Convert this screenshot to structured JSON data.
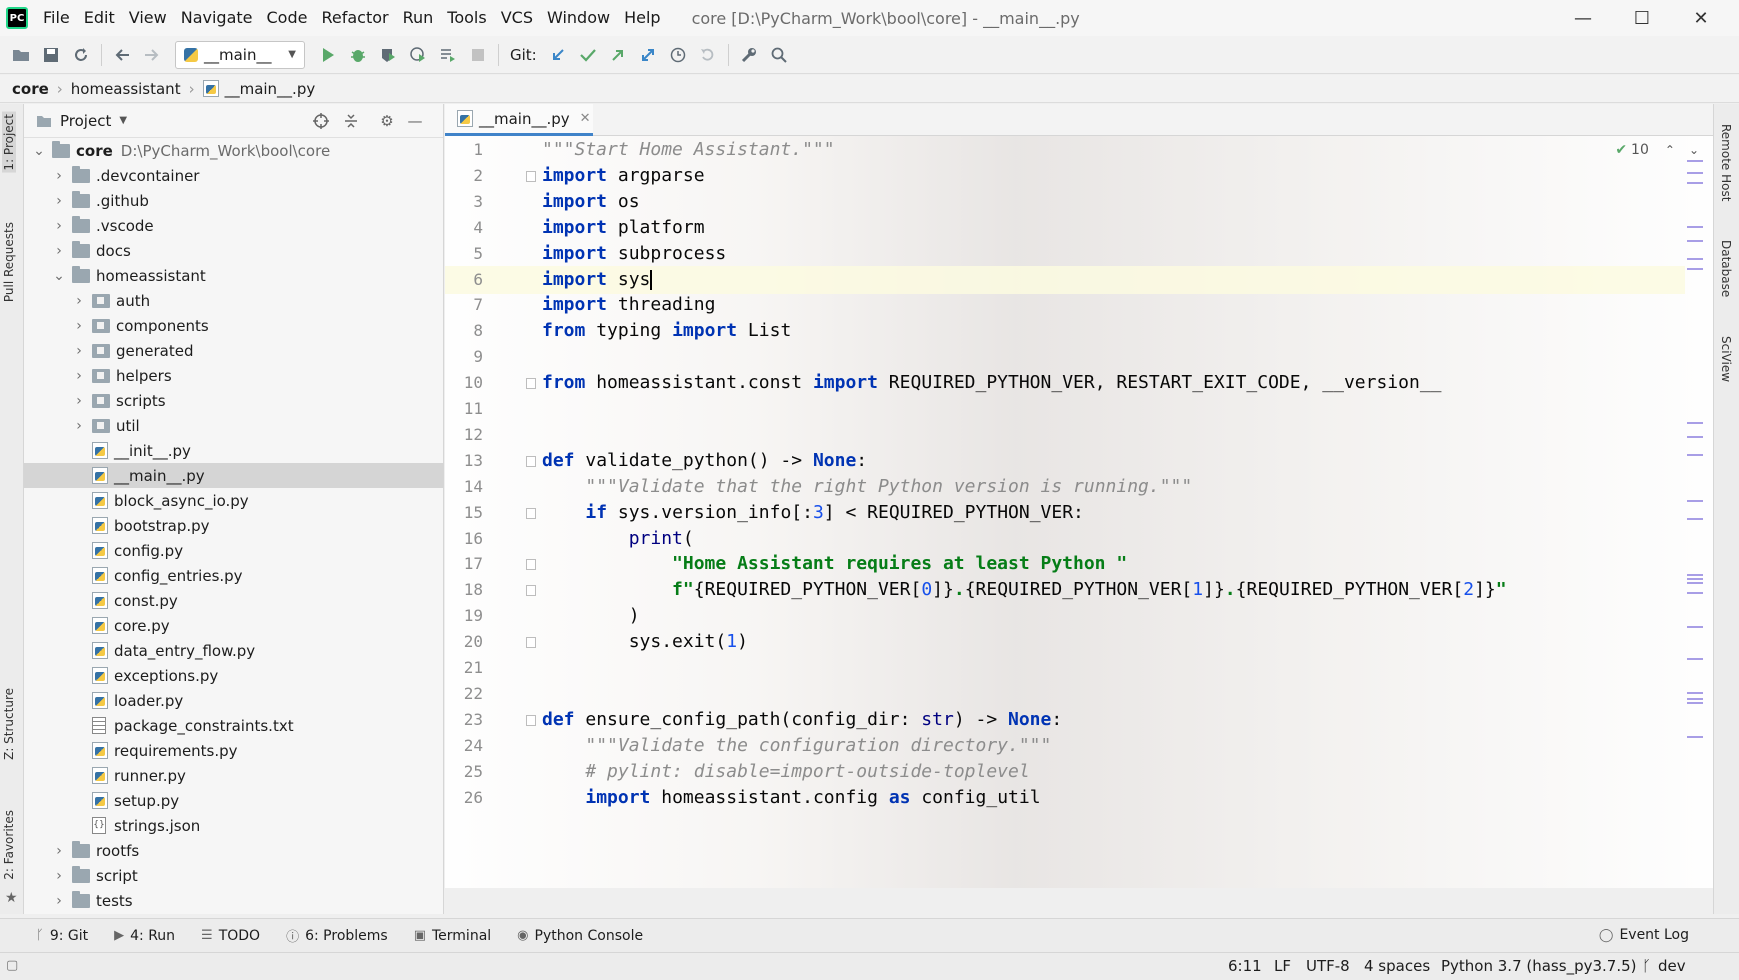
{
  "window": {
    "app_logo": "PC",
    "title": "core [D:\\PyCharm_Work\\bool\\core] - __main__.py",
    "minimize": "—",
    "maximize": "☐",
    "close": "✕"
  },
  "menu": [
    "File",
    "Edit",
    "View",
    "Navigate",
    "Code",
    "Refactor",
    "Run",
    "Tools",
    "VCS",
    "Window",
    "Help"
  ],
  "toolbar": {
    "run_config": "__main__",
    "git_label": "Git:"
  },
  "breadcrumb": [
    "core",
    "homeassistant",
    "__main__.py"
  ],
  "left_tabs": {
    "project": "1: Project",
    "pull_requests": "Pull Requests",
    "structure": "Z: Structure",
    "favorites": "2: Favorites"
  },
  "right_tabs": {
    "remote_host": "Remote Host",
    "database": "Database",
    "sciview": "SciView"
  },
  "project_panel": {
    "title": "Project",
    "tree": [
      {
        "label": "core",
        "path": "D:\\PyCharm_Work\\bool\\core",
        "type": "root",
        "depth": 0,
        "expanded": true
      },
      {
        "label": ".devcontainer",
        "type": "folder",
        "depth": 1,
        "expanded": false
      },
      {
        "label": ".github",
        "type": "folder",
        "depth": 1,
        "expanded": false
      },
      {
        "label": ".vscode",
        "type": "folder",
        "depth": 1,
        "expanded": false
      },
      {
        "label": "docs",
        "type": "folder",
        "depth": 1,
        "expanded": false
      },
      {
        "label": "homeassistant",
        "type": "folder",
        "depth": 1,
        "expanded": true
      },
      {
        "label": "auth",
        "type": "package",
        "depth": 2,
        "expanded": false
      },
      {
        "label": "components",
        "type": "package",
        "depth": 2,
        "expanded": false
      },
      {
        "label": "generated",
        "type": "package",
        "depth": 2,
        "expanded": false
      },
      {
        "label": "helpers",
        "type": "package",
        "depth": 2,
        "expanded": false
      },
      {
        "label": "scripts",
        "type": "package",
        "depth": 2,
        "expanded": false
      },
      {
        "label": "util",
        "type": "package",
        "depth": 2,
        "expanded": false
      },
      {
        "label": "__init__.py",
        "type": "py",
        "depth": 2
      },
      {
        "label": "__main__.py",
        "type": "py",
        "depth": 2,
        "selected": true
      },
      {
        "label": "block_async_io.py",
        "type": "py",
        "depth": 2
      },
      {
        "label": "bootstrap.py",
        "type": "py",
        "depth": 2
      },
      {
        "label": "config.py",
        "type": "py",
        "depth": 2
      },
      {
        "label": "config_entries.py",
        "type": "py",
        "depth": 2
      },
      {
        "label": "const.py",
        "type": "py",
        "depth": 2
      },
      {
        "label": "core.py",
        "type": "py",
        "depth": 2
      },
      {
        "label": "data_entry_flow.py",
        "type": "py",
        "depth": 2
      },
      {
        "label": "exceptions.py",
        "type": "py",
        "depth": 2
      },
      {
        "label": "loader.py",
        "type": "py",
        "depth": 2
      },
      {
        "label": "package_constraints.txt",
        "type": "txt",
        "depth": 2
      },
      {
        "label": "requirements.py",
        "type": "py",
        "depth": 2
      },
      {
        "label": "runner.py",
        "type": "py",
        "depth": 2
      },
      {
        "label": "setup.py",
        "type": "py",
        "depth": 2
      },
      {
        "label": "strings.json",
        "type": "json",
        "depth": 2
      },
      {
        "label": "rootfs",
        "type": "folder",
        "depth": 1,
        "expanded": false
      },
      {
        "label": "script",
        "type": "folder",
        "depth": 1,
        "expanded": false
      },
      {
        "label": "tests",
        "type": "folder",
        "depth": 1,
        "expanded": false
      }
    ]
  },
  "editor": {
    "tab_label": "__main__.py",
    "inspection_count": "10",
    "caret_line": 6,
    "line_numbers": [
      "1",
      "2",
      "3",
      "4",
      "5",
      "6",
      "7",
      "8",
      "9",
      "10",
      "11",
      "12",
      "13",
      "14",
      "15",
      "16",
      "17",
      "18",
      "19",
      "20",
      "21",
      "22",
      "23",
      "24",
      "25",
      "26"
    ],
    "code_lines": [
      [
        [
          "doc",
          "\"\"\"Start Home Assistant.\"\"\""
        ]
      ],
      [
        [
          "kw",
          "import"
        ],
        [
          "",
          " argparse"
        ]
      ],
      [
        [
          "kw",
          "import"
        ],
        [
          "",
          " os"
        ]
      ],
      [
        [
          "kw",
          "import"
        ],
        [
          "",
          " platform"
        ]
      ],
      [
        [
          "kw",
          "import"
        ],
        [
          "",
          " subprocess"
        ]
      ],
      [
        [
          "kw",
          "import"
        ],
        [
          "",
          " sys"
        ]
      ],
      [
        [
          "kw",
          "import"
        ],
        [
          "",
          " threading"
        ]
      ],
      [
        [
          "kw",
          "from"
        ],
        [
          "",
          " typing "
        ],
        [
          "kw",
          "import"
        ],
        [
          "",
          " List"
        ]
      ],
      [],
      [
        [
          "kw",
          "from"
        ],
        [
          "",
          " homeassistant.const "
        ],
        [
          "kw",
          "import"
        ],
        [
          "",
          " REQUIRED_PYTHON_VER, RESTART_EXIT_CODE, __version__"
        ]
      ],
      [],
      [],
      [
        [
          "kw",
          "def"
        ],
        [
          "",
          " validate_python() -> "
        ],
        [
          "kw",
          "None"
        ],
        [
          "",
          ":"
        ]
      ],
      [
        [
          "",
          "    "
        ],
        [
          "doc",
          "\"\"\"Validate that the right Python version is running.\"\"\""
        ]
      ],
      [
        [
          "",
          "    "
        ],
        [
          "kw",
          "if"
        ],
        [
          "",
          " sys.version_info[:"
        ],
        [
          "num",
          "3"
        ],
        [
          "",
          "] < REQUIRED_PYTHON_VER:"
        ]
      ],
      [
        [
          "",
          "        "
        ],
        [
          "bi",
          "print"
        ],
        [
          "",
          "("
        ]
      ],
      [
        [
          "",
          "            "
        ],
        [
          "str",
          "\"Home Assistant requires at least Python \""
        ]
      ],
      [
        [
          "",
          "            "
        ],
        [
          "str",
          "f\""
        ],
        [
          "",
          "{REQUIRED_PYTHON_VER["
        ],
        [
          "num",
          "0"
        ],
        [
          "",
          "]}"
        ],
        [
          "str",
          "."
        ],
        [
          "",
          "{REQUIRED_PYTHON_VER["
        ],
        [
          "num",
          "1"
        ],
        [
          "",
          "]}"
        ],
        [
          "str",
          "."
        ],
        [
          "",
          "{REQUIRED_PYTHON_VER["
        ],
        [
          "num",
          "2"
        ],
        [
          "",
          "]}"
        ],
        [
          "str",
          "\""
        ]
      ],
      [
        [
          "",
          "        )"
        ]
      ],
      [
        [
          "",
          "        sys.exit("
        ],
        [
          "num",
          "1"
        ],
        [
          "",
          ")"
        ]
      ],
      [],
      [],
      [
        [
          "kw",
          "def"
        ],
        [
          "",
          " ensure_config_path(config_dir: "
        ],
        [
          "bi",
          "str"
        ],
        [
          "",
          ") -> "
        ],
        [
          "kw",
          "None"
        ],
        [
          "",
          ":"
        ]
      ],
      [
        [
          "",
          "    "
        ],
        [
          "doc",
          "\"\"\"Validate the configuration directory.\"\"\""
        ]
      ],
      [
        [
          "",
          "    "
        ],
        [
          "cmt",
          "# pylint: disable=import-outside-toplevel"
        ]
      ],
      [
        [
          "",
          "    "
        ],
        [
          "kw",
          "import"
        ],
        [
          "",
          " homeassistant.config "
        ],
        [
          "kw",
          "as"
        ],
        [
          "",
          " config_util"
        ]
      ]
    ]
  },
  "bottom_tools": {
    "git": "9: Git",
    "run": "4: Run",
    "todo": "TODO",
    "problems": "6: Problems",
    "terminal": "Terminal",
    "python_console": "Python Console",
    "event_log": "Event Log"
  },
  "status": {
    "position": "6:11",
    "line_sep": "LF",
    "encoding": "UTF-8",
    "indent": "4 spaces",
    "interpreter": "Python 3.7 (hass_py3.7.5)",
    "branch": "dev"
  }
}
